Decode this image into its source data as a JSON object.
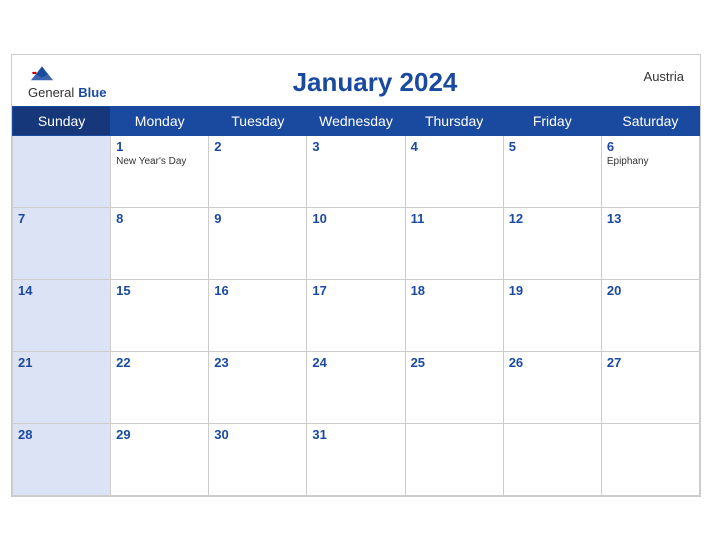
{
  "header": {
    "title": "January 2024",
    "country": "Austria",
    "logo_general": "General",
    "logo_blue": "Blue"
  },
  "weekdays": [
    "Sunday",
    "Monday",
    "Tuesday",
    "Wednesday",
    "Thursday",
    "Friday",
    "Saturday"
  ],
  "weeks": [
    [
      {
        "day": null,
        "holiday": null
      },
      {
        "day": "1",
        "holiday": "New Year's Day"
      },
      {
        "day": "2",
        "holiday": null
      },
      {
        "day": "3",
        "holiday": null
      },
      {
        "day": "4",
        "holiday": null
      },
      {
        "day": "5",
        "holiday": null
      },
      {
        "day": "6",
        "holiday": "Epiphany"
      }
    ],
    [
      {
        "day": "7",
        "holiday": null
      },
      {
        "day": "8",
        "holiday": null
      },
      {
        "day": "9",
        "holiday": null
      },
      {
        "day": "10",
        "holiday": null
      },
      {
        "day": "11",
        "holiday": null
      },
      {
        "day": "12",
        "holiday": null
      },
      {
        "day": "13",
        "holiday": null
      }
    ],
    [
      {
        "day": "14",
        "holiday": null
      },
      {
        "day": "15",
        "holiday": null
      },
      {
        "day": "16",
        "holiday": null
      },
      {
        "day": "17",
        "holiday": null
      },
      {
        "day": "18",
        "holiday": null
      },
      {
        "day": "19",
        "holiday": null
      },
      {
        "day": "20",
        "holiday": null
      }
    ],
    [
      {
        "day": "21",
        "holiday": null
      },
      {
        "day": "22",
        "holiday": null
      },
      {
        "day": "23",
        "holiday": null
      },
      {
        "day": "24",
        "holiday": null
      },
      {
        "day": "25",
        "holiday": null
      },
      {
        "day": "26",
        "holiday": null
      },
      {
        "day": "27",
        "holiday": null
      }
    ],
    [
      {
        "day": "28",
        "holiday": null
      },
      {
        "day": "29",
        "holiday": null
      },
      {
        "day": "30",
        "holiday": null
      },
      {
        "day": "31",
        "holiday": null
      },
      {
        "day": null,
        "holiday": null
      },
      {
        "day": null,
        "holiday": null
      },
      {
        "day": null,
        "holiday": null
      }
    ]
  ],
  "colors": {
    "header_bg": "#1a4a9f",
    "sunday_bg": "#dce3f5",
    "text_blue": "#1a4a9f"
  }
}
